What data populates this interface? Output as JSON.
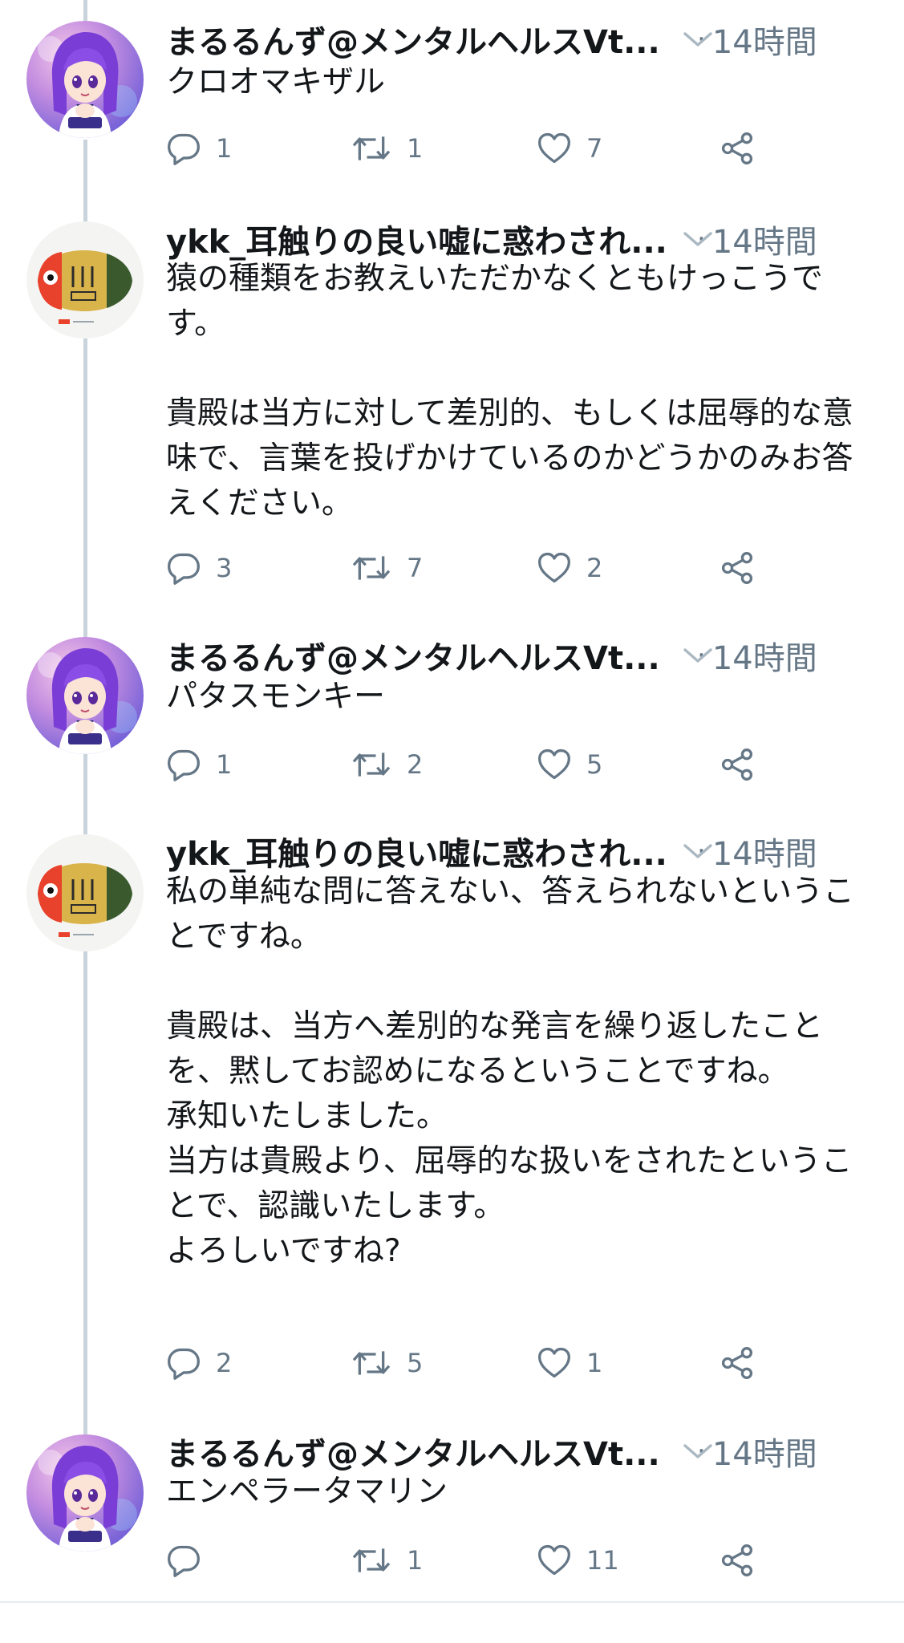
{
  "tweets": [
    {
      "author": "まるるんず@メンタルヘルスVt...",
      "time": "14時間",
      "text": "クロオマキザル",
      "replies": "1",
      "retweets": "1",
      "likes": "7"
    },
    {
      "author": "ykk_耳触りの良い嘘に惑わされ...",
      "time": "14時間",
      "text": "猿の種類をお教えいただかなくともけっこうです。\n\n貴殿は当方に対して差別的、もしくは屈辱的な意味で、言葉を投げかけているのかどうかのみお答えください。",
      "replies": "3",
      "retweets": "7",
      "likes": "2"
    },
    {
      "author": "まるるんず@メンタルヘルスVt...",
      "time": "14時間",
      "text": "パタスモンキー",
      "replies": "1",
      "retweets": "2",
      "likes": "5"
    },
    {
      "author": "ykk_耳触りの良い嘘に惑わされ...",
      "time": "14時間",
      "text": "私の単純な問に答えない、答えられないということですね。\n\n貴殿は、当方へ差別的な発言を繰り返したことを、黙してお認めになるということですね。\n承知いたしました。\n当方は貴殿より、屈辱的な扱いをされたということで、認識いたします。\nよろしいですね?",
      "replies": "2",
      "retweets": "5",
      "likes": "1"
    },
    {
      "author": "まるるんず@メンタルヘルスVt...",
      "time": "14時間",
      "text": "エンペラータマリン",
      "replies": "",
      "retweets": "1",
      "likes": "11"
    }
  ],
  "separator": "·",
  "icons": {
    "reply": "reply-icon",
    "retweet": "retweet-icon",
    "like": "heart-icon",
    "share": "share-icon",
    "more": "chevron-down-icon"
  },
  "colors": {
    "text": "#14171a",
    "secondary": "#657786",
    "thread_line": "#c9d3dc"
  }
}
